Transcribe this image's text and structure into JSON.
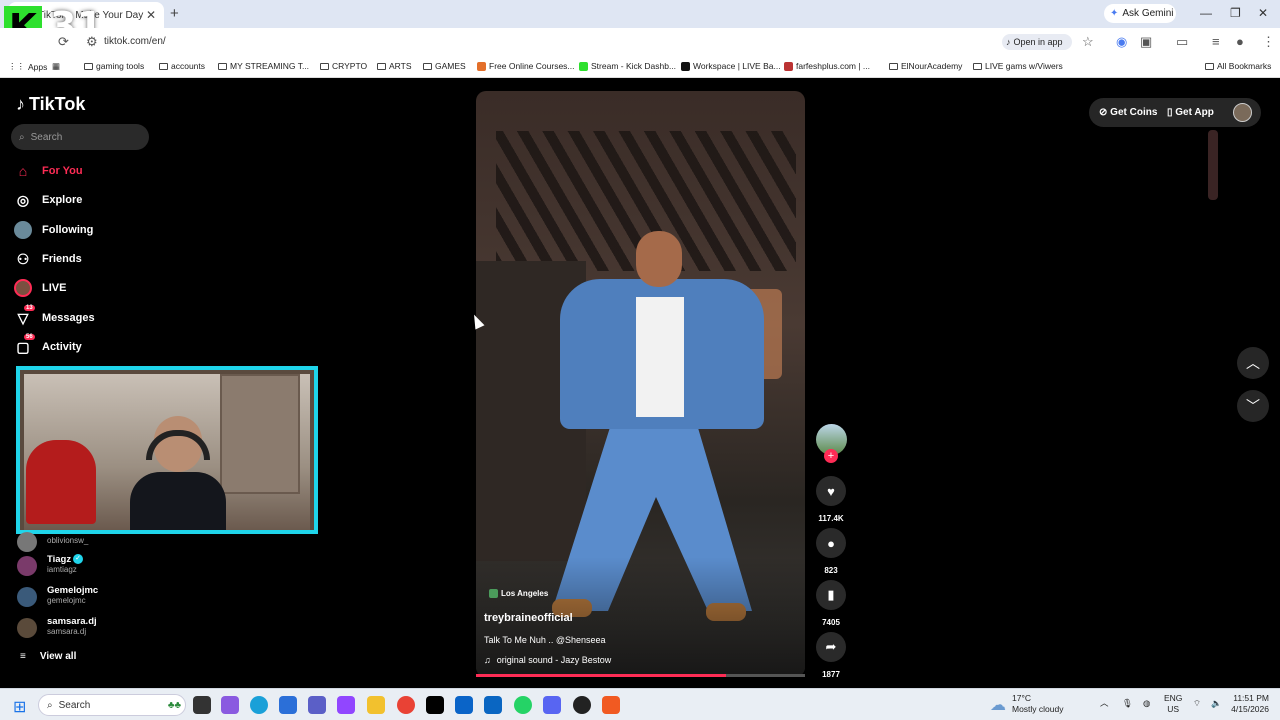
{
  "browser": {
    "tab_title": "TikTok - Make Your Day",
    "new_tab_icon": "plus-icon",
    "ask_gemini": "Ask Gemini",
    "url": "tiktok.com/en/",
    "open_in_app": "Open in app"
  },
  "overlay": {
    "k_letter": "K",
    "number": "31"
  },
  "bookmarks": [
    {
      "label": "Apps"
    },
    {
      "label": ""
    },
    {
      "label": "gaming tools"
    },
    {
      "label": "accounts"
    },
    {
      "label": "MY STREAMING T..."
    },
    {
      "label": "CRYPTO"
    },
    {
      "label": "ARTS"
    },
    {
      "label": "GAMES"
    },
    {
      "label": "Free Online Courses..."
    },
    {
      "label": "Stream - Kick Dashb..."
    },
    {
      "label": "Workspace | LIVE Ba..."
    },
    {
      "label": "farfeshplus.com | ..."
    },
    {
      "label": "ElNourAcademy"
    },
    {
      "label": "LIVE gams w/Viwers"
    },
    {
      "label": "All Bookmarks"
    }
  ],
  "tiktok": {
    "logo": "TikTok",
    "search_placeholder": "Search",
    "nav": [
      {
        "label": "For You",
        "icon": "home-icon"
      },
      {
        "label": "Explore",
        "icon": "compass-icon"
      },
      {
        "label": "Following",
        "icon": "following-avatar-icon"
      },
      {
        "label": "Friends",
        "icon": "friends-icon"
      },
      {
        "label": "LIVE",
        "icon": "live-icon"
      },
      {
        "label": "Messages",
        "icon": "messages-icon",
        "badge": "13"
      },
      {
        "label": "Activity",
        "icon": "activity-icon",
        "badge": "56"
      }
    ],
    "following_accounts": [
      {
        "name": "",
        "handle": "oblivionsw_"
      },
      {
        "name": "Tiagz",
        "handle": "iamtiagz",
        "verified": true
      },
      {
        "name": "Gemelojmc",
        "handle": "gemelojmc"
      },
      {
        "name": "samsara.dj",
        "handle": "samsara.dj"
      }
    ],
    "view_all": "View all",
    "header": {
      "get_coins": "Get Coins",
      "get_app": "Get App"
    }
  },
  "video": {
    "location": "Los Angeles",
    "author": "treybraineofficial",
    "caption": "Talk To Me Nuh .. @Shenseea",
    "sound": "original sound - Jazy Bestow",
    "progress": 0.76,
    "likes": "117.4K",
    "comments": "823",
    "bookmarks": "7405",
    "shares": "1877"
  },
  "taskbar": {
    "search_placeholder": "Search",
    "weather_temp": "17°C",
    "weather_desc": "Mostly cloudy",
    "lang1": "ENG",
    "lang2": "US",
    "time": "11:51 PM",
    "date": "4/15/2026"
  },
  "colors": {
    "accent": "#fe2c55",
    "webcam_border": "#1fd5ea",
    "webcam_accent": "#6f1ce2",
    "kick_green": "#2ee02e"
  }
}
